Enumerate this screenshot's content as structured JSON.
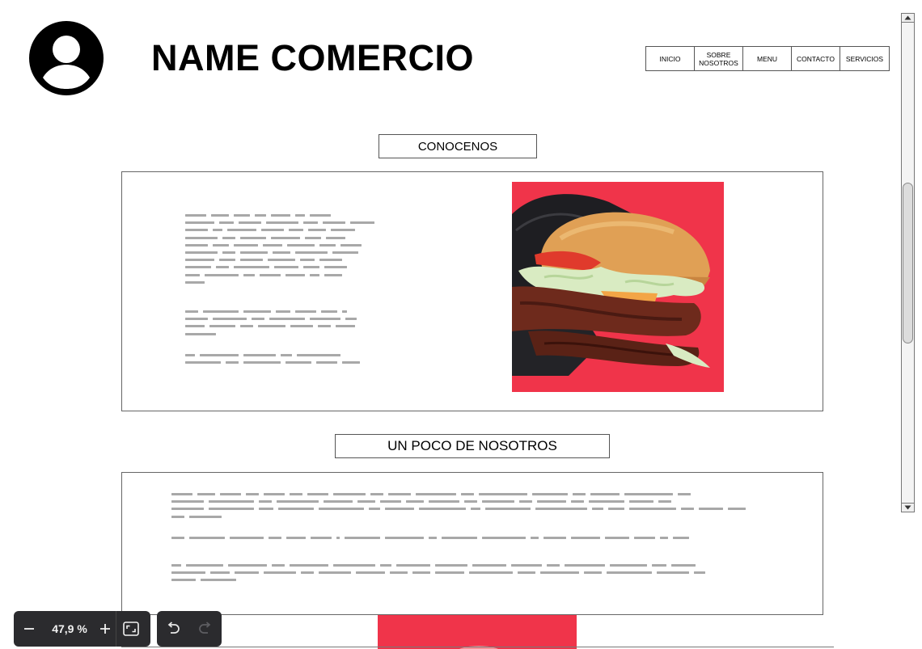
{
  "header": {
    "brand": "NAME COMERCIO",
    "nav": [
      "INICIO",
      "SOBRE\nNOSOTROS",
      "MENU",
      "CONTACTO",
      "SERVICIOS"
    ]
  },
  "sections": {
    "about": {
      "title": "CONOCENOS"
    },
    "us": {
      "title": "UN POCO DE NOSOTROS"
    }
  },
  "toolbar": {
    "zoom": "47,9 %",
    "icons": [
      "minus-icon",
      "plus-icon",
      "fit-screen-icon",
      "undo-icon",
      "redo-icon"
    ]
  },
  "colors": {
    "photo_background": "#f0344a",
    "placeholder_text": "#a8a8a8",
    "toolbar_bg": "#2b2b2e"
  }
}
